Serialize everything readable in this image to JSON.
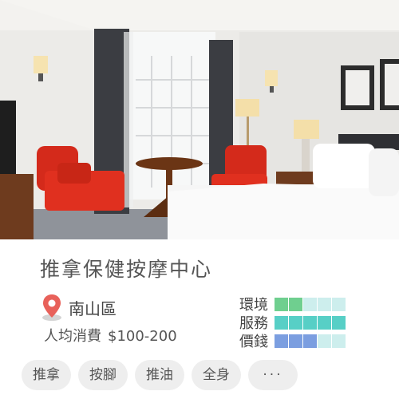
{
  "place": {
    "name": "推拿保健按摩中心",
    "district": "南山區",
    "price_label": "人均消費",
    "price_range": "$100-200"
  },
  "ratings": [
    {
      "label": "環境",
      "score": 2,
      "max": 5,
      "color_on": "#6fcf8f",
      "color_off": "#cdeeed"
    },
    {
      "label": "服務",
      "score": 5,
      "max": 5,
      "color_on": "#57cfc6",
      "color_off": "#cdeeed"
    },
    {
      "label": "價錢",
      "score": 3,
      "max": 5,
      "color_on": "#7b9ee0",
      "color_off": "#cdeeed"
    }
  ],
  "tags": [
    "推拿",
    "按腳",
    "推油",
    "全身"
  ],
  "more_label": "···",
  "icons": {
    "location": "map-pin-icon"
  },
  "colors": {
    "pin": "#e8615a",
    "tag_bg": "#eeeeee",
    "text": "#555555"
  }
}
